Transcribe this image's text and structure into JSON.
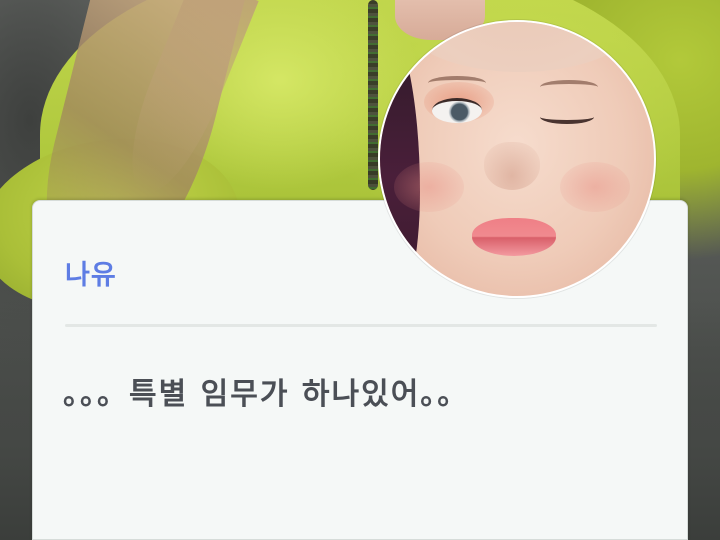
{
  "dialog": {
    "speaker": "나유",
    "text": "。。。특별 임무가 하나있어。。"
  },
  "colors": {
    "speaker_name": "#5e7de4",
    "dialog_text": "#4b4f56",
    "card_background": "#f5f8f7",
    "divider": "#e3e7e5",
    "sweater": "#b0c93e"
  }
}
